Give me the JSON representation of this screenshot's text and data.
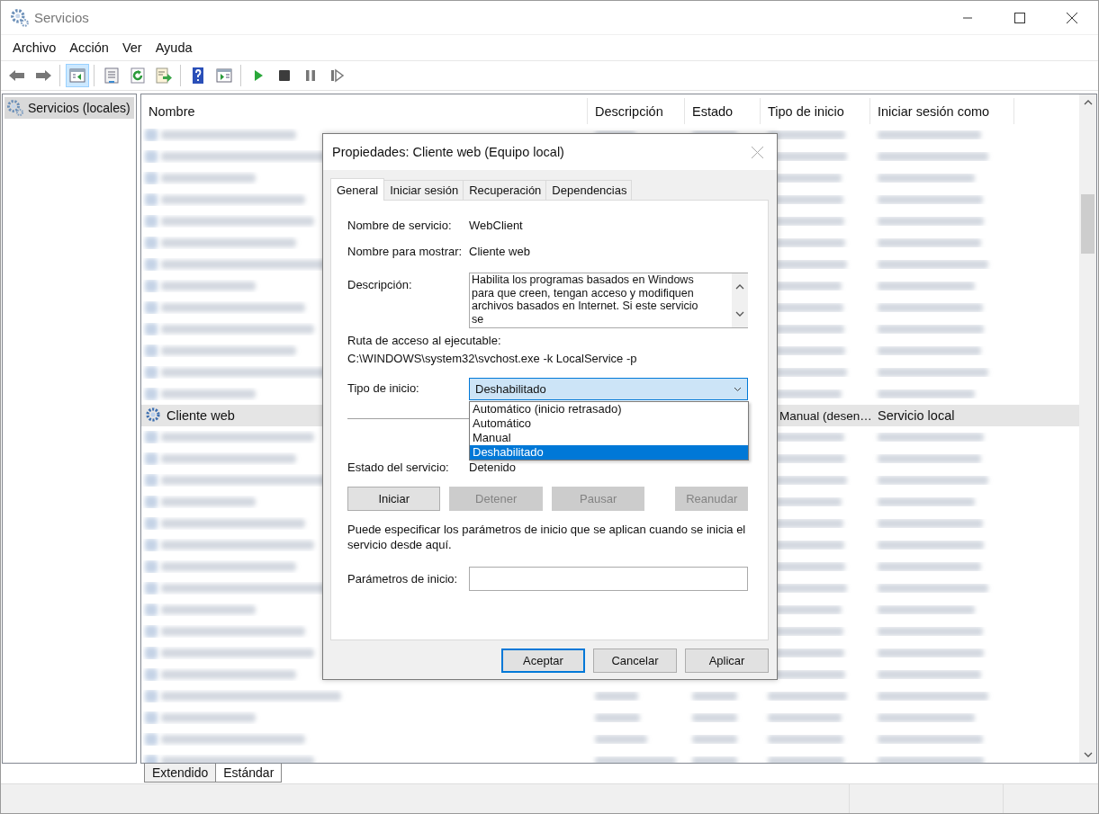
{
  "window": {
    "title": "Servicios"
  },
  "menu": [
    "Archivo",
    "Acción",
    "Ver",
    "Ayuda"
  ],
  "toolbar": [
    [
      {
        "kind": "back",
        "pressed": false
      },
      {
        "kind": "forward",
        "pressed": false
      }
    ],
    [
      {
        "kind": "tree",
        "pressed": true
      }
    ],
    [
      {
        "kind": "properties",
        "pressed": false
      },
      {
        "kind": "refresh",
        "pressed": false
      },
      {
        "kind": "export",
        "pressed": false
      }
    ],
    [
      {
        "kind": "help",
        "pressed": false
      },
      {
        "kind": "pane",
        "pressed": false
      }
    ],
    [
      {
        "kind": "play",
        "pressed": false
      },
      {
        "kind": "stop",
        "pressed": false
      },
      {
        "kind": "pause",
        "pressed": false
      },
      {
        "kind": "resume",
        "pressed": false
      }
    ]
  ],
  "tree": [
    {
      "label": "Servicios (locales)",
      "selected": true
    }
  ],
  "table": {
    "columns": [
      "Nombre",
      "Descripción",
      "Estado",
      "Tipo de inicio",
      "Iniciar sesión como"
    ],
    "rows": [
      {
        "kind": "blurred"
      },
      {
        "kind": "blurred"
      },
      {
        "kind": "blurred"
      },
      {
        "kind": "blurred"
      },
      {
        "kind": "blurred"
      },
      {
        "kind": "blurred"
      },
      {
        "kind": "blurred"
      },
      {
        "kind": "blurred"
      },
      {
        "kind": "blurred"
      },
      {
        "kind": "blurred"
      },
      {
        "kind": "blurred"
      },
      {
        "kind": "blurred"
      },
      {
        "kind": "blurred"
      },
      {
        "kind": "service",
        "name": "Cliente web",
        "startup_type": "Manual (desen…",
        "log_on_as": "Servicio local",
        "selected": true
      },
      {
        "kind": "blurred"
      },
      {
        "kind": "blurred"
      },
      {
        "kind": "blurred"
      },
      {
        "kind": "blurred"
      },
      {
        "kind": "blurred"
      },
      {
        "kind": "blurred"
      },
      {
        "kind": "blurred"
      },
      {
        "kind": "blurred"
      },
      {
        "kind": "blurred"
      },
      {
        "kind": "blurred"
      },
      {
        "kind": "blurred"
      },
      {
        "kind": "blurred"
      },
      {
        "kind": "blurred"
      },
      {
        "kind": "blurred"
      },
      {
        "kind": "blurred"
      },
      {
        "kind": "blurred"
      }
    ]
  },
  "view_tabs": [
    {
      "label": "Extendido",
      "selected": false
    },
    {
      "label": "Estándar",
      "selected": true
    }
  ],
  "dialog": {
    "title": "Propiedades: Cliente web (Equipo local)",
    "tabs": [
      {
        "label": "General",
        "selected": true
      },
      {
        "label": "Iniciar sesión",
        "selected": false
      },
      {
        "label": "Recuperación",
        "selected": false
      },
      {
        "label": "Dependencias",
        "selected": false
      }
    ],
    "fields": [
      {
        "label": "Nombre de servicio:",
        "value": "WebClient"
      },
      {
        "label": "Nombre para mostrar:",
        "value": "Cliente web"
      }
    ],
    "description": {
      "label": "Descripción:",
      "text": "Habilita los programas basados en Windows para que creen, tengan acceso y modifiquen archivos basados en Internet. Si este servicio se"
    },
    "path": {
      "label": "Ruta de acceso al ejecutable:",
      "value": "C:\\WINDOWS\\system32\\svchost.exe -k LocalService -p"
    },
    "startup_type": {
      "label": "Tipo de inicio:",
      "value": "Deshabilitado",
      "expanded": true,
      "options": [
        {
          "label": "Automático (inicio retrasado)",
          "selected": false
        },
        {
          "label": "Automático",
          "selected": false
        },
        {
          "label": "Manual",
          "selected": false
        },
        {
          "label": "Deshabilitado",
          "selected": true
        }
      ]
    },
    "status": {
      "label": "Estado del servicio:",
      "value": "Detenido"
    },
    "service_buttons": [
      {
        "label": "Iniciar",
        "disabled": false
      },
      {
        "label": "Detener",
        "disabled": true
      },
      {
        "label": "Pausar",
        "disabled": true
      },
      {
        "label": "Reanudar",
        "disabled": true
      }
    ],
    "hint": "Puede especificar los parámetros de inicio que se aplican cuando se inicia el servicio desde aquí.",
    "parameters": {
      "label": "Parámetros de inicio:"
    },
    "buttons": [
      {
        "label": "Aceptar",
        "default": true
      },
      {
        "label": "Cancelar",
        "default": false
      },
      {
        "label": "Aplicar",
        "default": false
      }
    ]
  }
}
